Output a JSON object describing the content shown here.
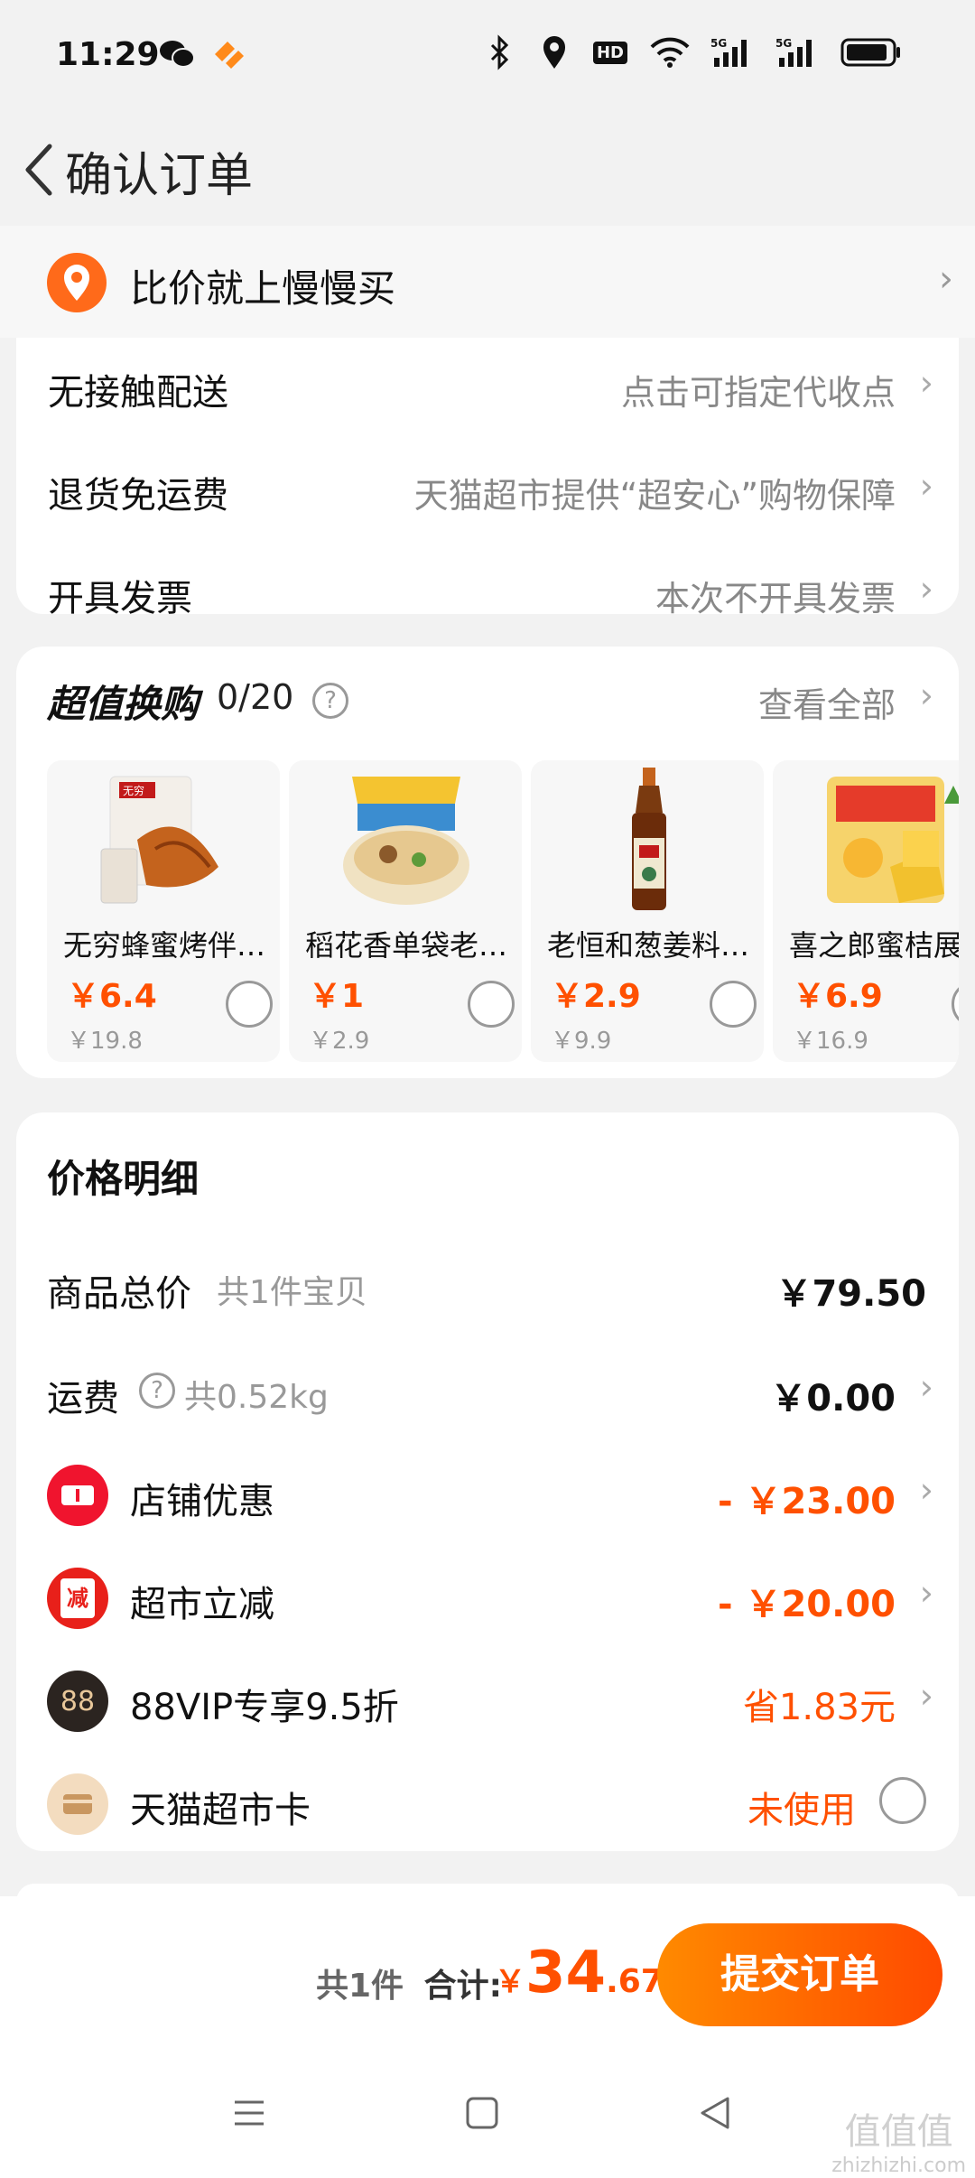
{
  "status": {
    "time": "11:29",
    "network": "5G",
    "hd": "HD"
  },
  "nav": {
    "title": "确认订单"
  },
  "banner": {
    "text": "比价就上慢慢买"
  },
  "delivery": {
    "rows": [
      {
        "label": "无接触配送",
        "value": "点击可指定代收点"
      },
      {
        "label": "退货免运费",
        "value": "天猫超市提供“超安心”购物保障"
      },
      {
        "label": "开具发票",
        "value": "本次不开具发票"
      }
    ]
  },
  "swap": {
    "title": "超值换购",
    "count": "0/20",
    "view_all": "查看全部",
    "products": [
      {
        "name": "无穷蜂蜜烤伴…",
        "price": "￥6.4",
        "orig": "￥19.8",
        "img_label": "无穷"
      },
      {
        "name": "稻花香单袋老…",
        "price": "￥1",
        "orig": "￥2.9",
        "img_label": ""
      },
      {
        "name": "老恒和葱姜料…",
        "price": "￥2.9",
        "orig": "￥9.9",
        "img_label": ""
      },
      {
        "name": "喜之郎蜜桔展",
        "price": "￥6.9",
        "orig": "￥16.9",
        "img_label": ""
      }
    ]
  },
  "price": {
    "title": "价格明细",
    "goods_label": "商品总价",
    "goods_sub": "共1件宝贝",
    "goods_value": "￥79.50",
    "freight_label": "运费",
    "freight_sub": "共0.52kg",
    "freight_value": "￥0.00",
    "shop_label": "店铺优惠",
    "shop_value": "- ￥23.00",
    "market_label": "超市立减",
    "market_icon_text": "减",
    "market_value": "- ￥20.00",
    "vip_label": "88VIP专享9.5折",
    "vip_icon_text": "88",
    "vip_value": "省1.83元",
    "card_label": "天猫超市卡",
    "card_value": "未使用"
  },
  "bottom": {
    "count": "共1件",
    "total_label": "合计:",
    "currency": "￥",
    "total_int": "34",
    "total_dec": ".67",
    "submit": "提交订单"
  },
  "watermark": {
    "line1": "值值值",
    "line2": "zhizhizhi.com"
  },
  "colors": {
    "accent": "#ff5000",
    "button_start": "#ff8a00",
    "button_end": "#ff4a00"
  }
}
